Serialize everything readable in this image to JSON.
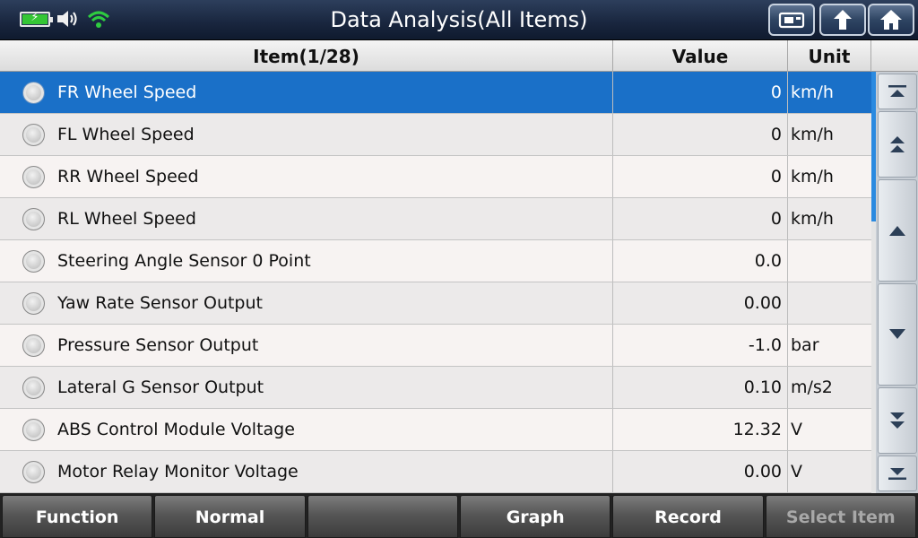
{
  "window": {
    "title": "Data Analysis(All Items)",
    "icons": [
      "battery-charging-icon",
      "speaker-icon",
      "wifi-icon",
      "print-icon",
      "back-icon",
      "home-icon"
    ]
  },
  "table": {
    "headers": {
      "item": "Item(1/28)",
      "value": "Value",
      "unit": "Unit"
    },
    "rows": [
      {
        "label": "FR Wheel Speed",
        "value": "0",
        "unit": "km/h",
        "selected": true
      },
      {
        "label": "FL Wheel Speed",
        "value": "0",
        "unit": "km/h"
      },
      {
        "label": "RR Wheel Speed",
        "value": "0",
        "unit": "km/h"
      },
      {
        "label": "RL Wheel Speed",
        "value": "0",
        "unit": "km/h"
      },
      {
        "label": "Steering Angle Sensor 0 Point",
        "value": "0.0",
        "unit": ""
      },
      {
        "label": "Yaw Rate Sensor Output",
        "value": "0.00",
        "unit": ""
      },
      {
        "label": "Pressure Sensor Output",
        "value": "-1.0",
        "unit": "bar"
      },
      {
        "label": "Lateral G Sensor Output",
        "value": "0.10",
        "unit": "m/s2"
      },
      {
        "label": "ABS Control Module Voltage",
        "value": "12.32",
        "unit": "V"
      },
      {
        "label": "Motor Relay Monitor Voltage",
        "value": "0.00",
        "unit": "V"
      }
    ]
  },
  "scroll": {
    "buttons": [
      "scroll-top",
      "page-up",
      "line-up",
      "line-down",
      "page-down",
      "scroll-bottom"
    ]
  },
  "toolbar": {
    "buttons": [
      {
        "label": "Function",
        "enabled": true
      },
      {
        "label": "Normal",
        "enabled": true
      },
      {
        "label": "",
        "enabled": false
      },
      {
        "label": "Graph",
        "enabled": true
      },
      {
        "label": "Record",
        "enabled": true
      },
      {
        "label": "Select Item",
        "enabled": false
      }
    ]
  },
  "colors": {
    "titlebar": "#1a2740",
    "selected_row": "#1a70c8",
    "battery": "#35c635",
    "wifi": "#2ecc40"
  }
}
